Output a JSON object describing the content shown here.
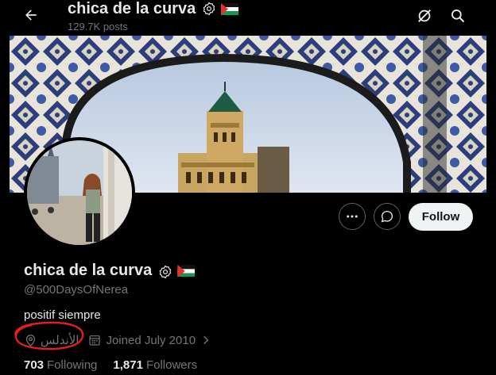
{
  "header": {
    "title": "chica de la curva",
    "posts_count": "129.7K posts"
  },
  "profile": {
    "display_name": "chica de la curva",
    "handle": "@500DaysOfNerea",
    "bio": "positif siempre",
    "location": "الأندلس",
    "joined": "Joined July 2010",
    "following_count": "703",
    "following_label": "Following",
    "followers_count": "1,871",
    "followers_label": "Followers"
  },
  "actions": {
    "follow_label": "Follow"
  },
  "icons": {
    "back": "arrow-left-icon",
    "grok": "grok-icon",
    "search": "search-icon",
    "more": "more-horizontal-icon",
    "message": "message-icon",
    "location": "location-pin-icon",
    "calendar": "calendar-icon",
    "verified": "verified-org-badge-icon",
    "flag": "palestine-flag-icon",
    "chevron": "chevron-right-icon"
  },
  "colors": {
    "background": "#000000",
    "primary_text": "#e7e9ea",
    "secondary_text": "#71767b",
    "follow_button_bg": "#eff3f4",
    "annotation_red": "#e0201f"
  }
}
